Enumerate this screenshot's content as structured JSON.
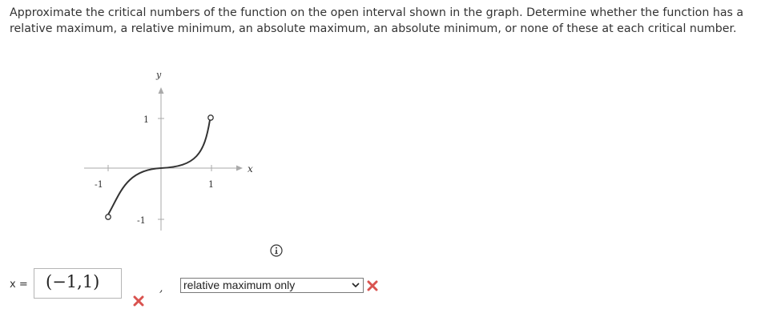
{
  "question": {
    "text": "Approximate the critical numbers of the function on the open interval shown in the graph. Determine whether the function has a relative maximum, a relative minimum, an absolute maximum, an absolute minimum, or none of these at each critical number."
  },
  "graph": {
    "y_axis_label": "y",
    "x_axis_label": "x",
    "x_ticks": [
      "-1",
      "1"
    ],
    "y_ticks": [
      "1",
      "-1"
    ]
  },
  "answer": {
    "x_label": "x =",
    "value": "(−1,1)",
    "comma": ",",
    "classification": "relative maximum only"
  },
  "colors": {
    "wrong_mark": "#d9534f"
  },
  "icons": [
    "info-icon",
    "wrong-mark-icon",
    "chevron-down-icon"
  ]
}
